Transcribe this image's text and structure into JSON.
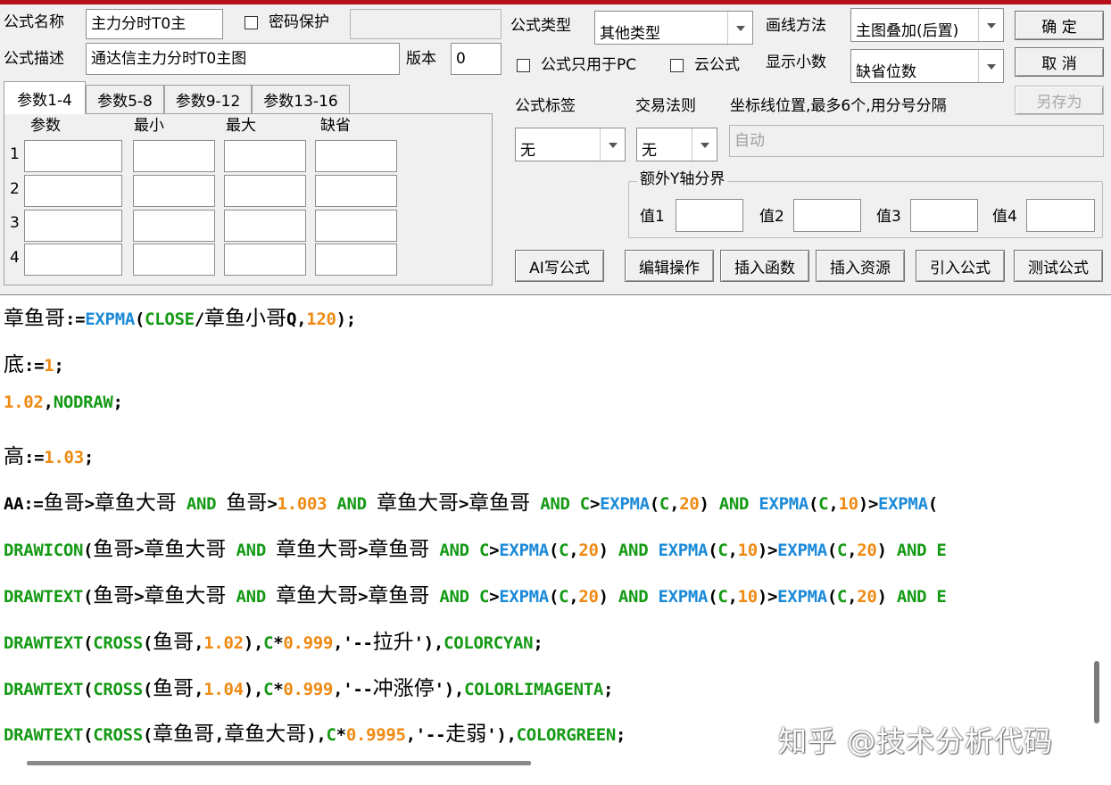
{
  "formula": {
    "name_label": "公式名称",
    "name_value": "主力分时T0主",
    "password_label": "密码保护",
    "desc_label": "公式描述",
    "desc_value": "通达信主力分时T0主图",
    "version_label": "版本",
    "version_value": "0",
    "type_label": "公式类型",
    "type_value": "其他类型",
    "draw_label": "画线方法",
    "draw_value": "主图叠加(后置)",
    "pc_only_label": "公式只用于PC",
    "cloud_label": "云公式",
    "decimal_label": "显示小数",
    "decimal_value": "缺省位数",
    "tag_label": "公式标签",
    "tag_value": "无",
    "trade_label": "交易法则",
    "trade_value": "无",
    "coord_label": "坐标线位置,最多6个,用分号分隔",
    "coord_value": "自动",
    "yaxis_label": "额外Y轴分界",
    "y_values": [
      "值1",
      "值2",
      "值3",
      "值4"
    ]
  },
  "buttons": {
    "ok": "确  定",
    "cancel": "取  消",
    "save_as": "另存为",
    "ai": "AI写公式",
    "edit": "编辑操作",
    "insert_fn": "插入函数",
    "insert_res": "插入资源",
    "import": "引入公式",
    "test": "测试公式"
  },
  "tabs": [
    "参数1-4",
    "参数5-8",
    "参数9-12",
    "参数13-16"
  ],
  "params": {
    "headers": [
      "参数",
      "最小",
      "最大",
      "缺省"
    ],
    "rows": [
      "1",
      "2",
      "3",
      "4"
    ]
  },
  "code_lines": [
    [
      [
        "cn",
        "章鱼哥"
      ],
      [
        "blk",
        ":="
      ],
      [
        "fn",
        "EXPMA"
      ],
      [
        "blk",
        "("
      ],
      [
        "kw",
        "CLOSE"
      ],
      [
        "blk",
        "/"
      ],
      [
        "cn",
        "章鱼小哥"
      ],
      [
        "blk",
        "Q,"
      ],
      [
        "num",
        "120"
      ],
      [
        "blk",
        ");"
      ]
    ],
    [
      [
        "cn",
        "底"
      ],
      [
        "blk",
        ":="
      ],
      [
        "num",
        "1"
      ],
      [
        "blk",
        ";"
      ]
    ],
    [
      [
        "num",
        "1.02"
      ],
      [
        "blk",
        ","
      ],
      [
        "kw",
        "NODRAW"
      ],
      [
        "blk",
        ";"
      ]
    ],
    [
      [
        "cn",
        "高"
      ],
      [
        "blk",
        ":="
      ],
      [
        "num",
        "1.03"
      ],
      [
        "blk",
        ";"
      ]
    ],
    [
      [
        "blk",
        "AA:="
      ],
      [
        "cn",
        "鱼哥"
      ],
      [
        "blk",
        ">"
      ],
      [
        "cn",
        "章鱼大哥"
      ],
      [
        "kw",
        " AND "
      ],
      [
        "cn",
        "鱼哥"
      ],
      [
        "blk",
        ">"
      ],
      [
        "num",
        "1.003"
      ],
      [
        "kw",
        " AND "
      ],
      [
        "cn",
        "章鱼大哥"
      ],
      [
        "blk",
        ">"
      ],
      [
        "cn",
        "章鱼哥"
      ],
      [
        "kw",
        " AND "
      ],
      [
        "kw",
        "C"
      ],
      [
        "blk",
        ">"
      ],
      [
        "fn",
        "EXPMA"
      ],
      [
        "blk",
        "("
      ],
      [
        "kw",
        "C"
      ],
      [
        "blk",
        ","
      ],
      [
        "num",
        "20"
      ],
      [
        "blk",
        ")"
      ],
      [
        "kw",
        " AND "
      ],
      [
        "fn",
        "EXPMA"
      ],
      [
        "blk",
        "("
      ],
      [
        "kw",
        "C"
      ],
      [
        "blk",
        ","
      ],
      [
        "num",
        "10"
      ],
      [
        "blk",
        ")>"
      ],
      [
        "fn",
        "EXPMA"
      ],
      [
        "blk",
        "("
      ]
    ],
    [
      [
        "kw",
        "DRAWICON"
      ],
      [
        "blk",
        "("
      ],
      [
        "cn",
        "鱼哥"
      ],
      [
        "blk",
        ">"
      ],
      [
        "cn",
        "章鱼大哥"
      ],
      [
        "kw",
        " AND "
      ],
      [
        "cn",
        "章鱼大哥"
      ],
      [
        "blk",
        ">"
      ],
      [
        "cn",
        "章鱼哥"
      ],
      [
        "kw",
        " AND "
      ],
      [
        "kw",
        "C"
      ],
      [
        "blk",
        ">"
      ],
      [
        "fn",
        "EXPMA"
      ],
      [
        "blk",
        "("
      ],
      [
        "kw",
        "C"
      ],
      [
        "blk",
        ","
      ],
      [
        "num",
        "20"
      ],
      [
        "blk",
        ")"
      ],
      [
        "kw",
        " AND "
      ],
      [
        "fn",
        "EXPMA"
      ],
      [
        "blk",
        "("
      ],
      [
        "kw",
        "C"
      ],
      [
        "blk",
        ","
      ],
      [
        "num",
        "10"
      ],
      [
        "blk",
        ")>"
      ],
      [
        "fn",
        "EXPMA"
      ],
      [
        "blk",
        "("
      ],
      [
        "kw",
        "C"
      ],
      [
        "blk",
        ","
      ],
      [
        "num",
        "20"
      ],
      [
        "blk",
        ")"
      ],
      [
        "kw",
        " AND E"
      ]
    ],
    [
      [
        "kw",
        "DRAWTEXT"
      ],
      [
        "blk",
        "("
      ],
      [
        "cn",
        "鱼哥"
      ],
      [
        "blk",
        ">"
      ],
      [
        "cn",
        "章鱼大哥"
      ],
      [
        "kw",
        " AND "
      ],
      [
        "cn",
        "章鱼大哥"
      ],
      [
        "blk",
        ">"
      ],
      [
        "cn",
        "章鱼哥"
      ],
      [
        "kw",
        " AND "
      ],
      [
        "kw",
        "C"
      ],
      [
        "blk",
        ">"
      ],
      [
        "fn",
        "EXPMA"
      ],
      [
        "blk",
        "("
      ],
      [
        "kw",
        "C"
      ],
      [
        "blk",
        ","
      ],
      [
        "num",
        "20"
      ],
      [
        "blk",
        ")"
      ],
      [
        "kw",
        " AND "
      ],
      [
        "fn",
        "EXPMA"
      ],
      [
        "blk",
        "("
      ],
      [
        "kw",
        "C"
      ],
      [
        "blk",
        ","
      ],
      [
        "num",
        "10"
      ],
      [
        "blk",
        ")>"
      ],
      [
        "fn",
        "EXPMA"
      ],
      [
        "blk",
        "("
      ],
      [
        "kw",
        "C"
      ],
      [
        "blk",
        ","
      ],
      [
        "num",
        "20"
      ],
      [
        "blk",
        ")"
      ],
      [
        "kw",
        " AND E"
      ]
    ],
    [
      [
        "kw",
        "DRAWTEXT"
      ],
      [
        "blk",
        "("
      ],
      [
        "kw",
        "CROSS"
      ],
      [
        "blk",
        "("
      ],
      [
        "cn",
        "鱼哥"
      ],
      [
        "blk",
        ","
      ],
      [
        "num",
        "1.02"
      ],
      [
        "blk",
        "),"
      ],
      [
        "kw",
        "C"
      ],
      [
        "blk",
        "*"
      ],
      [
        "num",
        "0.999"
      ],
      [
        "blk",
        ",'--"
      ],
      [
        "cn",
        "拉升"
      ],
      [
        "blk",
        "'),"
      ],
      [
        "kw",
        "COLORCYAN"
      ],
      [
        "blk",
        ";"
      ]
    ],
    [
      [
        "kw",
        "DRAWTEXT"
      ],
      [
        "blk",
        "("
      ],
      [
        "kw",
        "CROSS"
      ],
      [
        "blk",
        "("
      ],
      [
        "cn",
        "鱼哥"
      ],
      [
        "blk",
        ","
      ],
      [
        "num",
        "1.04"
      ],
      [
        "blk",
        "),"
      ],
      [
        "kw",
        "C"
      ],
      [
        "blk",
        "*"
      ],
      [
        "num",
        "0.999"
      ],
      [
        "blk",
        ",'--"
      ],
      [
        "cn",
        "冲涨停"
      ],
      [
        "blk",
        "'),"
      ],
      [
        "kw",
        "COLORLIMAGENTA"
      ],
      [
        "blk",
        ";"
      ]
    ],
    [
      [
        "kw",
        "DRAWTEXT"
      ],
      [
        "blk",
        "("
      ],
      [
        "kw",
        "CROSS"
      ],
      [
        "blk",
        "("
      ],
      [
        "cn",
        "章鱼哥"
      ],
      [
        "blk",
        ","
      ],
      [
        "cn",
        "章鱼大哥"
      ],
      [
        "blk",
        "),"
      ],
      [
        "kw",
        "C"
      ],
      [
        "blk",
        "*"
      ],
      [
        "num",
        "0.9995"
      ],
      [
        "blk",
        ",'--"
      ],
      [
        "cn",
        "走弱"
      ],
      [
        "blk",
        "'),"
      ],
      [
        "kw",
        "COLORGREEN"
      ],
      [
        "blk",
        ";"
      ]
    ]
  ],
  "watermark": "知乎 @技术分析代码"
}
